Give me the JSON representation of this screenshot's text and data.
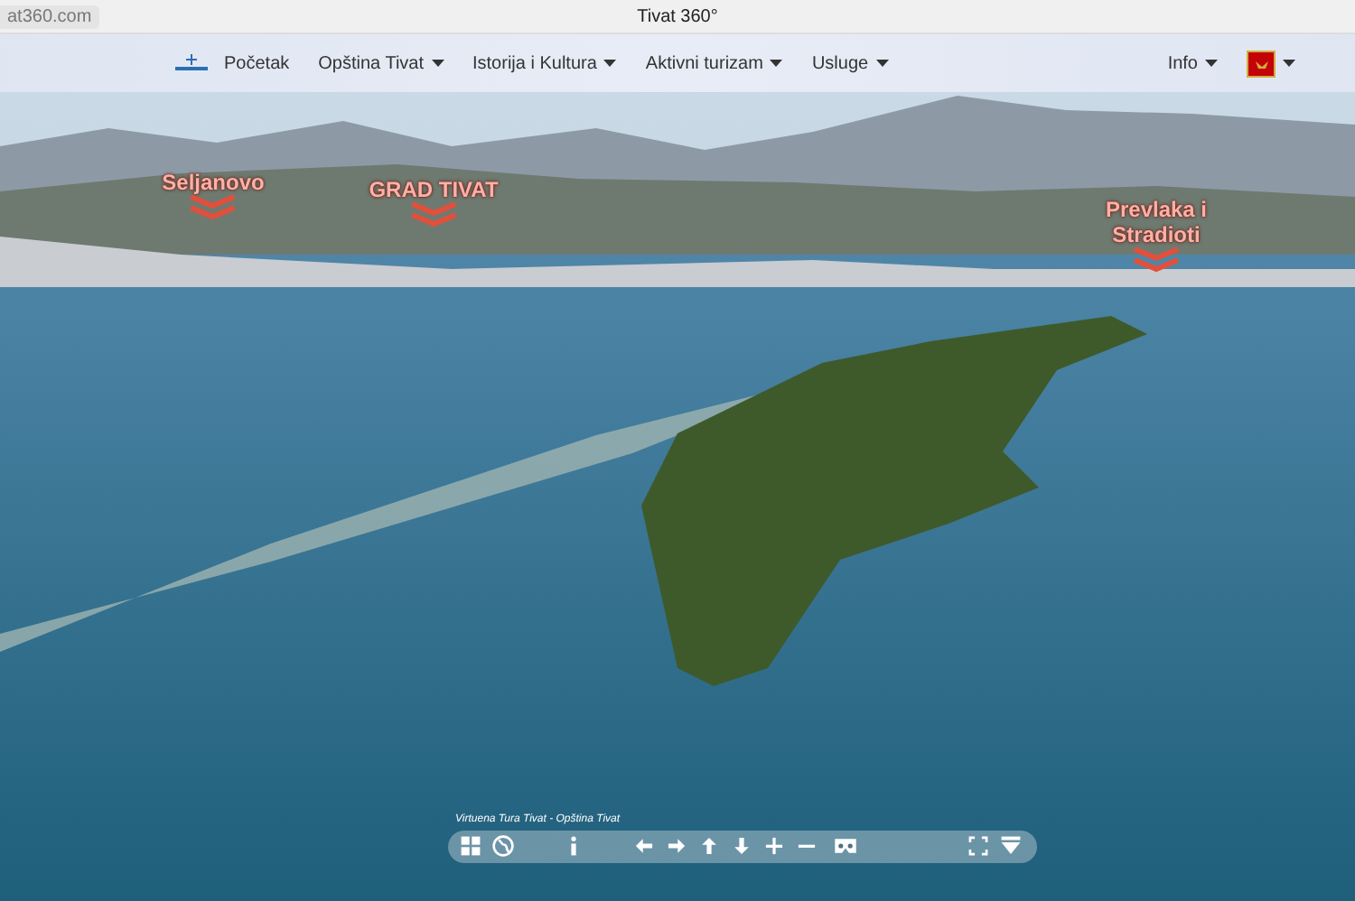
{
  "browser": {
    "address": "at360.com",
    "title": "Tivat 360°"
  },
  "nav": {
    "items": [
      {
        "label": "Početak",
        "dropdown": false
      },
      {
        "label": "Opština Tivat",
        "dropdown": true
      },
      {
        "label": "Istorija i Kultura",
        "dropdown": true
      },
      {
        "label": "Aktivni turizam",
        "dropdown": true
      },
      {
        "label": "Usluge",
        "dropdown": true
      }
    ],
    "right": [
      {
        "kind": "text",
        "label": "Info",
        "dropdown": true
      },
      {
        "kind": "flag",
        "dropdown": true
      }
    ]
  },
  "hotspots": [
    {
      "label": "Seljanovo"
    },
    {
      "label": "GRAD TIVAT"
    },
    {
      "label": "Prevlaka i Stradioti"
    }
  ],
  "viewer": {
    "caption": "Virtuena Tura Tivat - Opština Tivat"
  }
}
